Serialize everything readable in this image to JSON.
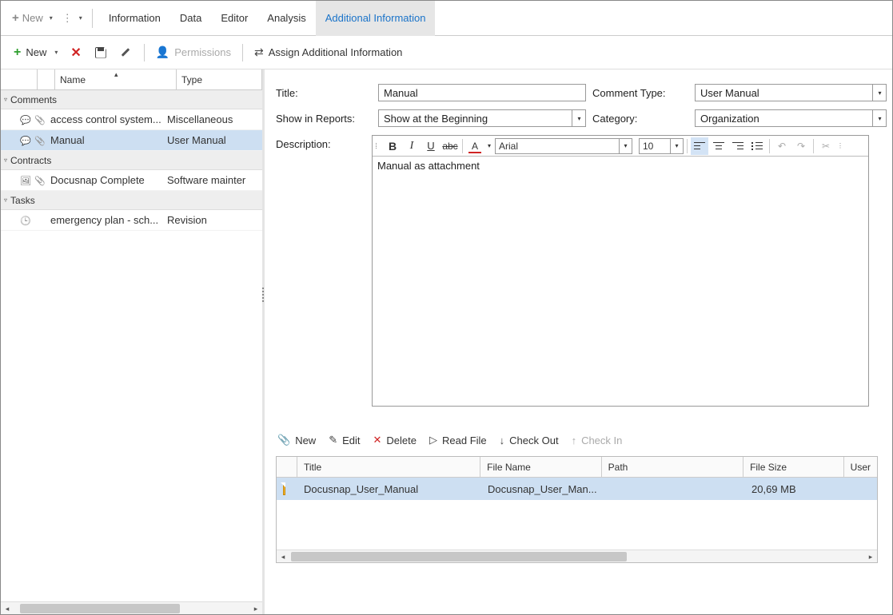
{
  "topbar": {
    "new_label": "New",
    "tabs": [
      {
        "label": "Information"
      },
      {
        "label": "Data"
      },
      {
        "label": "Editor"
      },
      {
        "label": "Analysis"
      },
      {
        "label": "Additional Information",
        "active": true
      }
    ]
  },
  "actionbar": {
    "new_label": "New",
    "permissions_label": "Permissions",
    "assign_label": "Assign Additional Information"
  },
  "left_panel": {
    "columns": {
      "name": "Name",
      "type": "Type"
    },
    "groups": [
      {
        "title": "Comments",
        "items": [
          {
            "icon": "chat",
            "clip": true,
            "name": "access control system...",
            "type": "Miscellaneous"
          },
          {
            "icon": "chat",
            "clip": true,
            "name": "Manual",
            "type": "User Manual",
            "selected": true
          }
        ]
      },
      {
        "title": "Contracts",
        "items": [
          {
            "icon": "pic",
            "clip": true,
            "name": "Docusnap Complete",
            "type": "Software mainter"
          }
        ]
      },
      {
        "title": "Tasks",
        "items": [
          {
            "icon": "clock",
            "clip": false,
            "name": "emergency plan - sch...",
            "type": "Revision"
          }
        ]
      }
    ]
  },
  "form": {
    "title_label": "Title:",
    "title_value": "Manual",
    "show_label": "Show in Reports:",
    "show_value": "Show at the Beginning",
    "desc_label": "Description:",
    "comment_type_label": "Comment Type:",
    "comment_type_value": "User Manual",
    "category_label": "Category:",
    "category_value": "Organization"
  },
  "editor": {
    "font_name": "Arial",
    "font_size": "10",
    "body_text": "Manual as attachment"
  },
  "attachments": {
    "bar": {
      "new": "New",
      "edit": "Edit",
      "delete": "Delete",
      "read_file": "Read File",
      "check_out": "Check Out",
      "check_in": "Check In"
    },
    "columns": {
      "title": "Title",
      "file_name": "File Name",
      "path": "Path",
      "file_size": "File Size",
      "user": "User"
    },
    "rows": [
      {
        "title": "Docusnap_User_Manual",
        "file_name": "Docusnap_User_Man...",
        "path": "",
        "file_size": "20,69 MB",
        "user": ""
      }
    ]
  }
}
